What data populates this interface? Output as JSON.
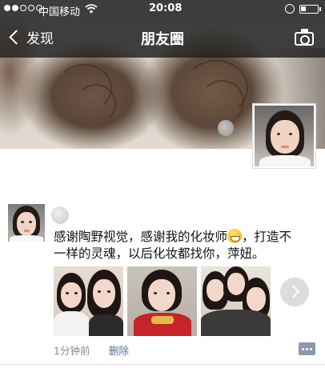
{
  "status_bar": {
    "carrier": "中国移动",
    "time": "20:08"
  },
  "nav": {
    "back_label": "发现",
    "title": "朋友圈"
  },
  "icons": {
    "back": "chevron-left-icon",
    "camera": "camera-icon",
    "wifi": "wifi-icon",
    "alarm": "alarm-icon",
    "battery": "battery-icon",
    "more": "chevron-right-icon",
    "comment": "comment-icon"
  },
  "post": {
    "text_line1_a": "感谢陶野视觉，感谢我的化妆师",
    "text_line1_b": "，打造不",
    "text_line2": "一样的灵魂，以后化妆都找你，萍妞。",
    "emoji": "grin-emoji",
    "time_ago": "1分钟前",
    "delete_label": "删除",
    "photo_count": 3
  },
  "colors": {
    "link": "#576b95",
    "meta": "#8a8a8a",
    "header_overlay": "#1e1e1e"
  }
}
